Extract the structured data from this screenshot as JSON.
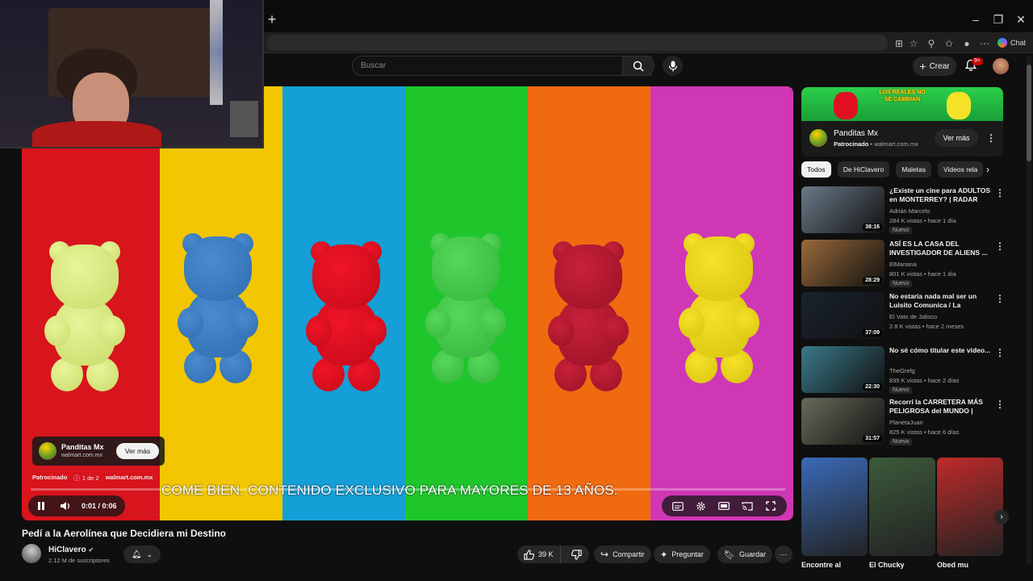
{
  "browser": {
    "chat_label": "Chat",
    "window_minimize": "–",
    "window_maximize": "❐",
    "window_close": "✕",
    "new_tab": "+"
  },
  "header": {
    "search_placeholder": "Buscar",
    "create_label": "Crear",
    "notifications_badge": "9+"
  },
  "player": {
    "stripe_colors": [
      "#d8141d",
      "#f2c600",
      "#149fd6",
      "#1ec62c",
      "#f06a10",
      "#cf37b4"
    ],
    "bears": [
      {
        "color": "#e8f59a",
        "shade": "#c9db6a"
      },
      {
        "color": "#4a8bd0",
        "shade": "#2f6db0"
      },
      {
        "color": "#f01528",
        "shade": "#c50a18"
      },
      {
        "color": "#55d85a",
        "shade": "#36b53c"
      },
      {
        "color": "#c8213a",
        "shade": "#9a1226"
      },
      {
        "color": "#f5e228",
        "shade": "#d8c20e"
      }
    ],
    "ad": {
      "name": "Panditas Mx",
      "url": "walmart.com.mx",
      "button": "Ver más",
      "sponsored": "Patrocinado",
      "position": "1 de 2",
      "domain": "walmart.com.mx"
    },
    "subtitle": "COME BIEN. CONTENIDO EXCLUSIVO PARA MAYORES DE 13 AÑOS.",
    "time": "0:01 / 0:06",
    "progress": 0.003
  },
  "video": {
    "title": "Pedí a la Aerolínea que Decidiera mi Destino",
    "channel": "HiClavero",
    "subscribers": "2.12 M de suscriptores",
    "likes": "39 K",
    "share": "Compartir",
    "ask": "Preguntar",
    "save": "Guardar"
  },
  "sidebar": {
    "ad": {
      "banner_text": "LOS REALES NO SE CAMBIAN",
      "name": "Panditas Mx",
      "sponsored": "Patrocinado",
      "url": "walmart.com.mx",
      "button": "Ver más"
    },
    "chips": [
      "Todos",
      "De HiClavero",
      "Maletas",
      "Videos rela"
    ],
    "recommendations": [
      {
        "title": "¿Existe un cine para ADULTOS en MONTERREY? | RADAR con...",
        "channel": "Adrián Marcelo",
        "meta": "284 K vistas • hace 1 día",
        "badge": "Nuevo",
        "duration": "38:16",
        "thumb": "#6a7a88"
      },
      {
        "title": "ASÍ ES LA CASA DEL INVESTIGADOR DE ALIENS ...",
        "channel": "ElMariana",
        "meta": "801 K vistas • hace 1 día",
        "badge": "Nuevo",
        "duration": "28:29",
        "thumb": "#9a6a3a"
      },
      {
        "title": "No estaria nada mal ser un Luisito Comunica / La pregunt...",
        "channel": "El Vato de Jalisco",
        "meta": "2.8 K vistas • hace 2 meses",
        "badge": "",
        "duration": "37:09",
        "thumb": "#1a2330"
      },
      {
        "title": "No sé cómo titular este video...",
        "channel": "TheGrefg",
        "meta": "835 K vistas • hace 2 días",
        "badge": "Nuevo",
        "duration": "22:30",
        "thumb": "#3a7a8a"
      },
      {
        "title": "Recorrí la CARRETERA MÁS PELIGROSA del MUNDO | Ruta...",
        "channel": "PlanetaJuan",
        "meta": "825 K vistas • hace 6 días",
        "badge": "Nuevo",
        "duration": "31:57",
        "thumb": "#6a6a5a"
      }
    ],
    "shorts": [
      {
        "title": "Encontre al",
        "color": "#3a6ab8"
      },
      {
        "title": "El Chucky",
        "color": "#3c5a3a"
      },
      {
        "title": "Obed mu",
        "color": "#c02a2a"
      }
    ]
  }
}
